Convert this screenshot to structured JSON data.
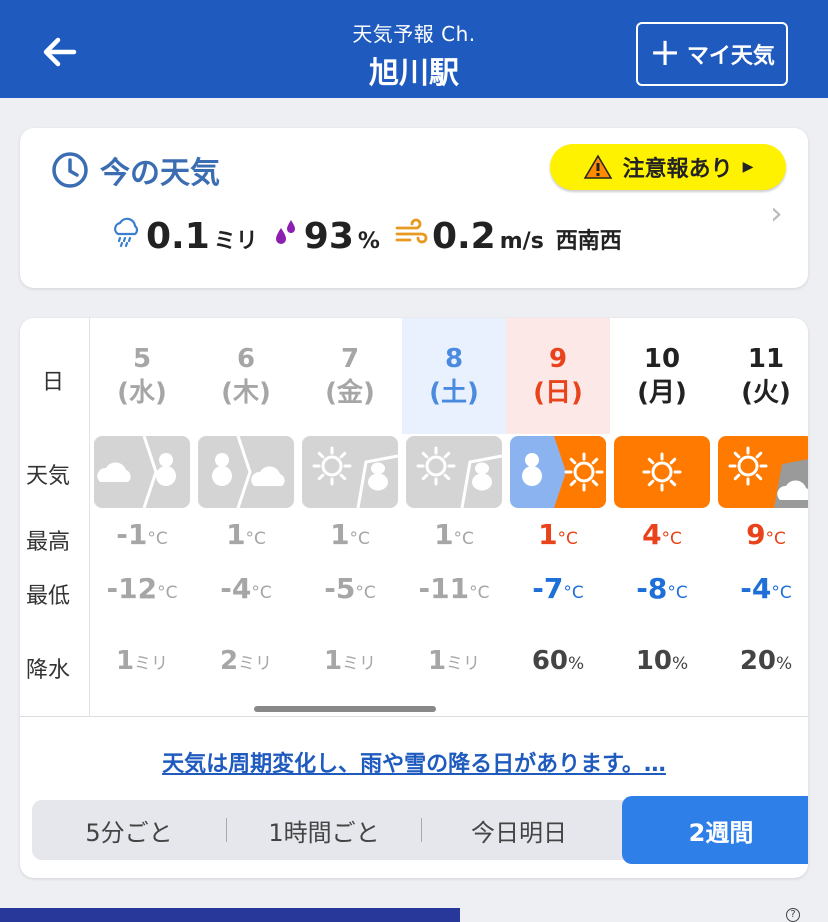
{
  "header": {
    "subtitle": "天気予報 Ch.",
    "title": "旭川駅",
    "my_weather_label": "マイ天気",
    "bg_color": "#1f5bbf"
  },
  "now": {
    "title": "今の天気",
    "alert_label": "注意報あり",
    "precip_value": "0.1",
    "precip_unit": "ミリ",
    "humidity_value": "93",
    "humidity_unit": "%",
    "wind_value": "0.2",
    "wind_unit": "m/s",
    "wind_dir": "西南西"
  },
  "forecast": {
    "row_labels": {
      "day": "日",
      "weather": "天気",
      "high": "最高",
      "low": "最低",
      "precip": "降水"
    },
    "temp_unit": "°C",
    "days": [
      {
        "date": "5",
        "weekday": "(水)",
        "weather": "cloud-snow",
        "high": "-1",
        "low": "-12",
        "precip": "1",
        "precip_unit": "ミリ",
        "past": true
      },
      {
        "date": "6",
        "weekday": "(木)",
        "weather": "snow-cloud",
        "high": "1",
        "low": "-4",
        "precip": "2",
        "precip_unit": "ミリ",
        "past": true
      },
      {
        "date": "7",
        "weekday": "(金)",
        "weather": "sun-snow",
        "high": "1",
        "low": "-5",
        "precip": "1",
        "precip_unit": "ミリ",
        "past": true
      },
      {
        "date": "8",
        "weekday": "(土)",
        "weather": "sun-snow",
        "high": "1",
        "low": "-11",
        "precip": "1",
        "precip_unit": "ミリ",
        "past": true
      },
      {
        "date": "9",
        "weekday": "(日)",
        "weather": "snow-sun",
        "high": "1",
        "low": "-7",
        "precip": "60",
        "precip_unit": "%",
        "past": false
      },
      {
        "date": "10",
        "weekday": "(月)",
        "weather": "sun",
        "high": "4",
        "low": "-8",
        "precip": "10",
        "precip_unit": "%",
        "past": false
      },
      {
        "date": "11",
        "weekday": "(火)",
        "weather": "sun-cloud",
        "high": "9",
        "low": "-4",
        "precip": "20",
        "precip_unit": "%",
        "past": false
      }
    ],
    "summary": "天気は周期変化し、雨や雪の降る日があります。…"
  },
  "tabs": [
    {
      "label": "5分ごと",
      "active": false
    },
    {
      "label": "1時間ごと",
      "active": false
    },
    {
      "label": "今日明日",
      "active": false
    },
    {
      "label": "2週間",
      "active": true
    }
  ],
  "colors": {
    "accent": "#2f7fe8",
    "high_red": "#e8431b",
    "low_blue": "#1f6fd8",
    "saturday": "#4a8be0",
    "sunday": "#e8431b",
    "sun_orange": "#ff7a00",
    "past_gray": "#d4d4d4"
  }
}
